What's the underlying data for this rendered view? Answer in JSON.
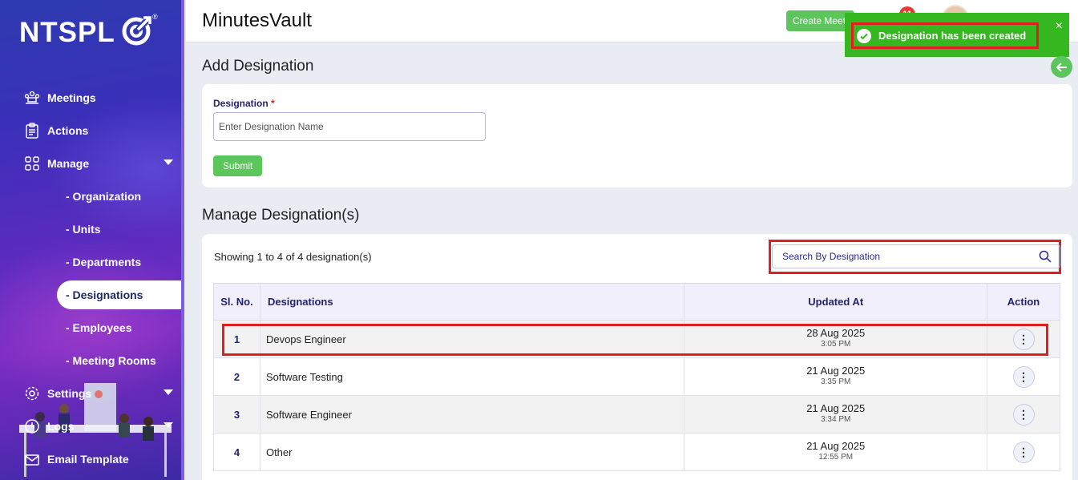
{
  "sidebar": {
    "logo_text": "NTSPL",
    "logo_reg": "®",
    "items": [
      {
        "label": "Meetings",
        "icon": "meetings-icon"
      },
      {
        "label": "Actions",
        "icon": "clipboard-icon"
      },
      {
        "label": "Manage",
        "icon": "grid-icon"
      }
    ],
    "sub_items": [
      "- Organization",
      "- Units",
      "- Departments",
      "- Designations",
      "- Employees",
      "- Meeting Rooms"
    ],
    "bottom_items": [
      {
        "label": "Settings",
        "icon": "gear-icon"
      },
      {
        "label": "Logs",
        "icon": "clock-icon"
      },
      {
        "label": "Email Template",
        "icon": "envelope-icon"
      }
    ]
  },
  "header": {
    "app_title": "MinutesVault",
    "create_meeting": "Create Meeti",
    "notification_count": "11"
  },
  "toast": {
    "message": "Designation has been created",
    "close": "×",
    "color": "#35b81f"
  },
  "add_section": {
    "title": "Add Designation",
    "field_label": "Designation",
    "required_mark": "*",
    "placeholder": "Enter Designation Name",
    "submit": "Submit"
  },
  "manage_section": {
    "title": "Manage Designation(s)",
    "showing": "Showing 1 to 4 of 4 designation(s)",
    "search_placeholder": "Search By Designation",
    "columns": [
      "Sl. No.",
      "Designations",
      "Updated At",
      "Action"
    ],
    "rows": [
      {
        "sl": "1",
        "name": "Devops Engineer",
        "date": "28 Aug 2025",
        "time": "3:05 PM"
      },
      {
        "sl": "2",
        "name": "Software Testing",
        "date": "21 Aug 2025",
        "time": "3:35 PM"
      },
      {
        "sl": "3",
        "name": "Software Engineer",
        "date": "21 Aug 2025",
        "time": "3:34 PM"
      },
      {
        "sl": "4",
        "name": "Other",
        "date": "21 Aug 2025",
        "time": "12:55 PM"
      }
    ],
    "action_glyph": "⋮"
  },
  "colors": {
    "accent_green": "#5cc65c",
    "highlight_red": "#e02020",
    "navy_text": "#23236e"
  }
}
